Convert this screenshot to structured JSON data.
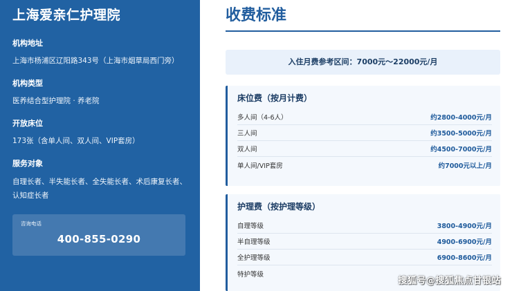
{
  "sidebar": {
    "org_name": "上海爱亲仁护理院",
    "fields": [
      {
        "label": "机构地址",
        "value": "上海市杨浦区辽阳路343号（上海市烟草局西门旁）"
      },
      {
        "label": "机构类型",
        "value": "医养结合型护理院 · 养老院"
      },
      {
        "label": "开放床位",
        "value": "173张（含单人间、双人间、VIP套房）"
      },
      {
        "label": "服务对象",
        "value": "自理长者、半失能长者、全失能长者、术后康复长者、认知症长者"
      }
    ],
    "phone": {
      "label": "咨询电话",
      "number": "400-855-0290"
    }
  },
  "main": {
    "title": "收费标准",
    "range_text": "入住月费参考区间：7000元～22000元/月",
    "bed_card": {
      "title": "床位费（按月计费）",
      "rows": [
        {
          "name": "多人间（4-6人）",
          "value": "约2800-4000元/月"
        },
        {
          "name": "三人间",
          "value": "约3500-5000元/月"
        },
        {
          "name": "双人间",
          "value": "约4500-7000元/月"
        },
        {
          "name": "单人间/VIP套房",
          "value": "约7000元以上/月"
        }
      ]
    },
    "care_card": {
      "title": "护理费（按护理等级）",
      "rows": [
        {
          "name": "自理等级",
          "value": "3800-4900元/月"
        },
        {
          "name": "半自理等级",
          "value": "4900-6900元/月"
        },
        {
          "name": "全护理等级",
          "value": "6900-8600元/月"
        },
        {
          "name": "特护等级",
          "value": ""
        }
      ]
    }
  },
  "watermark": "搜狐号@搜狐焦点甘银站",
  "colors": {
    "sidebar_bg": "#2162a3",
    "accent": "#215d9e",
    "range_bg": "#e9f1fb",
    "card_bg": "#f4f8fd"
  }
}
